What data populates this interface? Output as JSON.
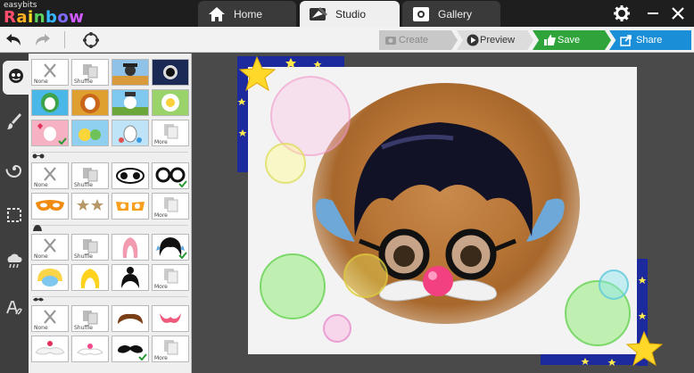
{
  "app": {
    "brand_small": "easybits",
    "brand_letters": [
      "R",
      "a",
      "i",
      "n",
      "b",
      "o",
      "w"
    ]
  },
  "tabs": [
    {
      "label": "Home",
      "icon": "house-icon",
      "active": false
    },
    {
      "label": "Studio",
      "icon": "paint-icon",
      "active": true
    },
    {
      "label": "Gallery",
      "icon": "gallery-icon",
      "active": false
    }
  ],
  "window": {
    "settings_icon": "gear-icon",
    "minimize_icon": "minimize-icon",
    "close_icon": "close-icon"
  },
  "toolbar": {
    "undo_icon": "undo-icon",
    "redo_icon": "redo-icon",
    "rotate_icon": "lasso-icon",
    "create_label": "Create",
    "preview_label": "Preview",
    "save_label": "Save",
    "share_label": "Share"
  },
  "rail": {
    "items": [
      {
        "icon": "face-icon",
        "active": true
      },
      {
        "icon": "brush-icon",
        "active": false
      },
      {
        "icon": "spiral-icon",
        "active": false
      },
      {
        "icon": "frame-icon",
        "active": false
      },
      {
        "icon": "weather-icon",
        "active": false
      },
      {
        "icon": "text-icon",
        "active": false
      }
    ]
  },
  "panel": {
    "none_label": "None",
    "shuffle_label": "Shuffle",
    "more_label": "More",
    "sections": [
      {
        "name": "scenes",
        "icon": ""
      },
      {
        "name": "glasses",
        "icon": "glasses-icon"
      },
      {
        "name": "hair",
        "icon": "hat-icon"
      },
      {
        "name": "mustache",
        "icon": "mustache-icon"
      }
    ]
  },
  "colors": {
    "accent_save": "#2ea43a",
    "accent_share": "#1a8fd8",
    "titlebar": "#1e1e1e"
  }
}
